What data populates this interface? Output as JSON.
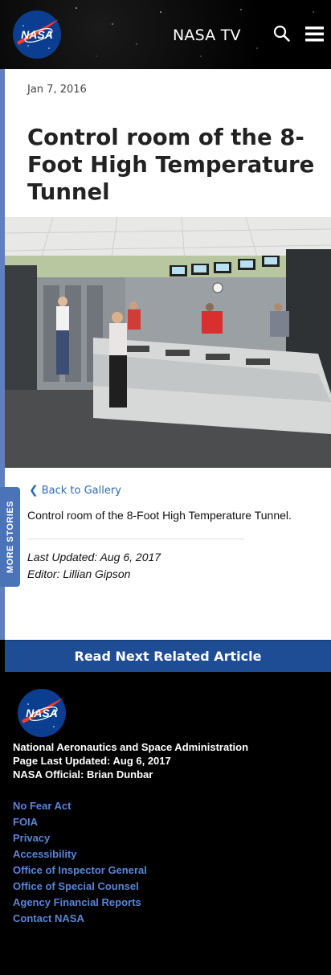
{
  "header": {
    "logo_text": "NASA",
    "nasa_tv_label": "NASA TV",
    "search_icon": "search-icon",
    "menu_icon": "hamburger-menu-icon"
  },
  "article": {
    "date": "Jan 7, 2016",
    "title": "Control room of the 8-Foot High Temperature Tunnel",
    "back_link": "Back to Gallery",
    "caption": "Control room of the 8-Foot High Temperature Tunnel.",
    "last_updated": "Last Updated: Aug 6, 2017",
    "editor": "Editor: Lillian Gipson"
  },
  "more_stories": "MORE STORIES",
  "read_next": "Read Next Related Article",
  "footer": {
    "logo_text": "NASA",
    "agency_name": "National Aeronautics and Space Administration",
    "page_last_updated": "Page Last Updated: Aug 6, 2017",
    "official": "NASA Official: Brian Dunbar",
    "links": [
      "No Fear Act",
      "FOIA",
      "Privacy",
      "Accessibility",
      "Office of Inspector General",
      "Office of Special Counsel",
      "Agency Financial Reports",
      "Contact NASA"
    ]
  },
  "colors": {
    "brand_blue": "#0b3d91",
    "nasa_red": "#fc3d21",
    "link_blue": "#2e6ab2",
    "footer_link": "#5b85d6",
    "read_next_bg": "#1e4d96"
  }
}
